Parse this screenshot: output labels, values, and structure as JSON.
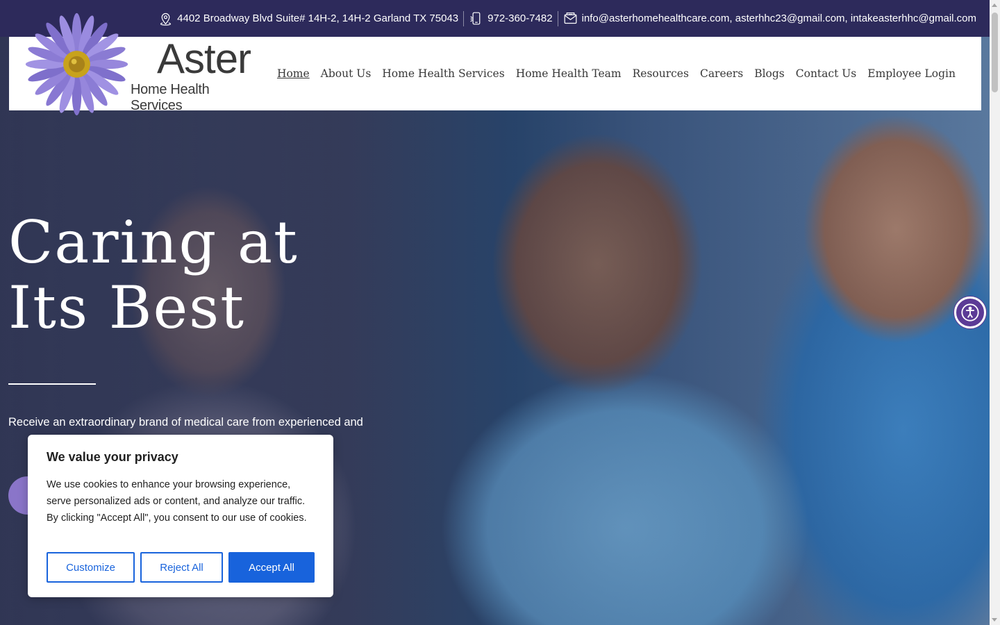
{
  "topbar": {
    "address": "4402 Broadway Blvd Suite# 14H-2, 14H-2 Garland TX 75043",
    "phone": "972-360-7482",
    "emails": "info@asterhomehealthcare.com, asterhhc23@gmail.com, intakeasterhhc@gmail.com",
    "icons": [
      "location-pin-icon",
      "phone-icon",
      "envelope-icon"
    ]
  },
  "logo": {
    "name": "Aster",
    "subtitle": "Home Health Services"
  },
  "nav": {
    "items": [
      {
        "label": "Home",
        "active": true
      },
      {
        "label": "About Us"
      },
      {
        "label": "Home Health Services"
      },
      {
        "label": "Home Health Team"
      },
      {
        "label": "Resources"
      },
      {
        "label": "Careers"
      },
      {
        "label": "Blogs"
      },
      {
        "label": "Contact Us"
      },
      {
        "label": "Employee Login"
      }
    ]
  },
  "hero": {
    "title_line1": "Caring at",
    "title_line2": "Its Best",
    "description": "Receive an extraordinary brand of medical care from experienced and",
    "button_label": ""
  },
  "cookie": {
    "title": "We value your privacy",
    "body": "We use cookies to enhance your browsing experience, serve personalized ads or content, and analyze our traffic. By clicking \"Accept All\", you consent to our use of cookies.",
    "customize_label": "Customize",
    "reject_label": "Reject All",
    "accept_label": "Accept All"
  },
  "colors": {
    "topbar_bg": "#2d2a5b",
    "brand_purple": "#8a75c9",
    "accept_blue": "#1863dc",
    "a11y_purple": "#5c3b96"
  }
}
